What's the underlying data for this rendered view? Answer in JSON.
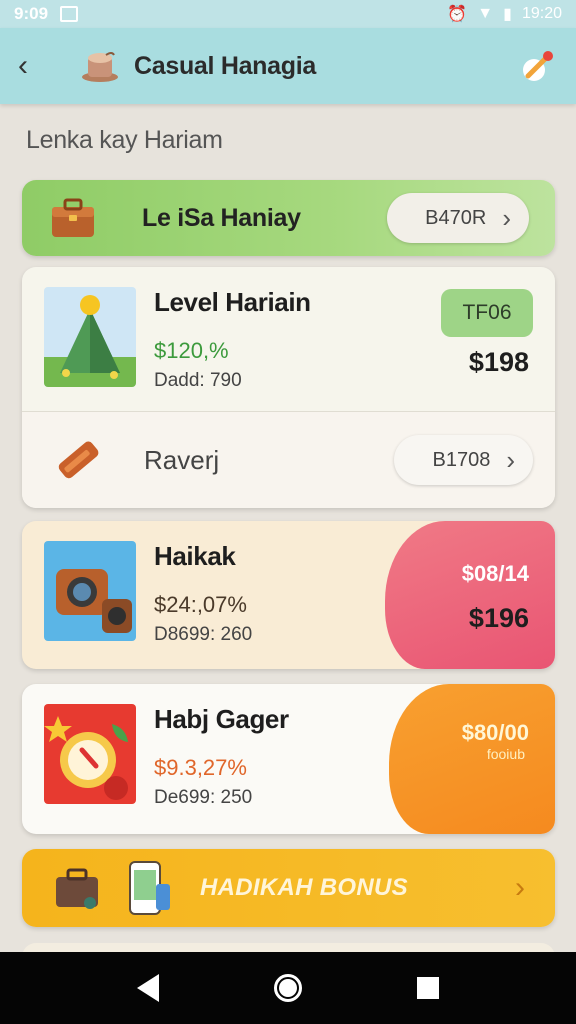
{
  "status_bar": {
    "time": "9:09",
    "clock": "19:20"
  },
  "app_bar": {
    "title": "Casual Hanagia"
  },
  "section_title": "Lenka kay Hariam",
  "banner": {
    "title": "Le iSa Haniay",
    "button_label": "B470R"
  },
  "level_card": {
    "name": "Level Hariain",
    "percent": "$120,%",
    "sub": "Dadd: 790",
    "badge": "TF06",
    "price": "$198",
    "footer_label": "Raverj",
    "footer_button": "B1708"
  },
  "offers": [
    {
      "name": "Haikak",
      "percent": "$24:,07%",
      "sub": "D8699: 260",
      "blob_price": "$08/14",
      "price": "$196",
      "percent_color": "#4a3a2a"
    },
    {
      "name": "Habj Gager",
      "percent": "$9.3,27%",
      "sub": "De699: 250",
      "blob_price": "$80/00",
      "blob_sub": "fooiub",
      "percent_color": "#e0662a"
    }
  ],
  "bonus": {
    "label": "HADIKAH BONUS"
  },
  "colors": {
    "header": "#a9dde0",
    "green": "#8fcc66",
    "pink": "#e95573",
    "orange": "#f58a1f",
    "bonus": "#f5b41c",
    "green_text": "#3c9a3c"
  }
}
